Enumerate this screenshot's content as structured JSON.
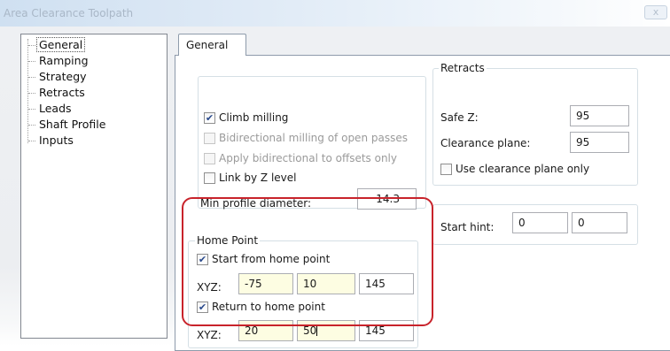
{
  "window": {
    "title": "Area Clearance Toolpath",
    "title_button": "x"
  },
  "tree": {
    "items": [
      {
        "label": "General",
        "selected": true
      },
      {
        "label": "Ramping"
      },
      {
        "label": "Strategy"
      },
      {
        "label": "Retracts"
      },
      {
        "label": "Leads"
      },
      {
        "label": "Shaft Profile"
      },
      {
        "label": "Inputs"
      }
    ]
  },
  "tabs": [
    {
      "label": "General"
    }
  ],
  "options": {
    "climb_milling": {
      "label": "Climb milling",
      "checked": true
    },
    "bidirectional": {
      "label": "Bidirectional milling of open passes",
      "checked": false,
      "enabled": false
    },
    "apply_bidirectional": {
      "label": "Apply bidirectional to offsets only",
      "checked": false,
      "enabled": false
    },
    "link_by_z": {
      "label": "Link by Z level",
      "checked": false
    },
    "min_profile": {
      "label": "Min profile diameter:",
      "value": "14.3"
    }
  },
  "retracts": {
    "title": "Retracts",
    "safe_z": {
      "label": "Safe Z:",
      "value": "95"
    },
    "clearance_plane": {
      "label": "Clearance plane:",
      "value": "95"
    },
    "use_clearance_only": {
      "label": "Use clearance plane only",
      "checked": false
    }
  },
  "start_hint": {
    "label": "Start hint:",
    "x": "0",
    "y": "0"
  },
  "home_point": {
    "title": "Home Point",
    "start_from": {
      "label": "Start from home point",
      "checked": true
    },
    "start_xyz": {
      "label": "XYZ:",
      "x": "-75",
      "y": "10",
      "z": "145"
    },
    "return_to": {
      "label": "Return to home point",
      "checked": true
    },
    "return_xyz": {
      "label": "XYZ:",
      "x": "20",
      "y": "50",
      "z": "145"
    }
  },
  "colors": {
    "highlight": "#c8232b",
    "field_highlight": "#fdfde2",
    "checkmark": "#2a4a8c"
  }
}
